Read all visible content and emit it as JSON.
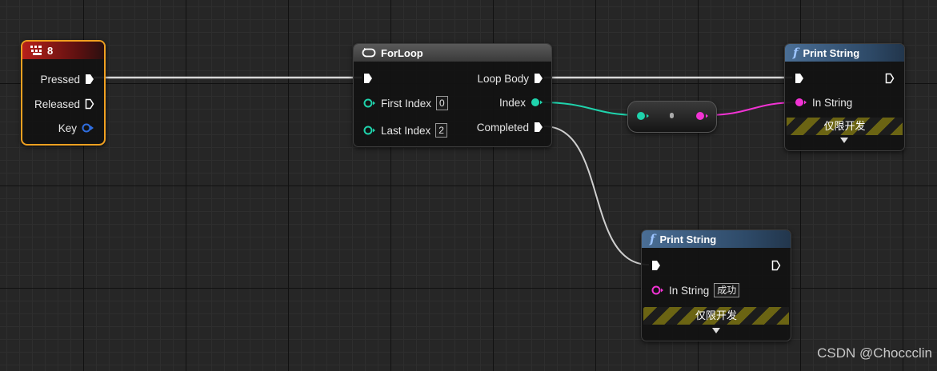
{
  "key_event": {
    "title": "8",
    "pins": {
      "pressed": "Pressed",
      "released": "Released",
      "key": "Key"
    },
    "icon": "keyboard-icon"
  },
  "for_loop": {
    "title": "ForLoop",
    "icon": "loop-icon",
    "first_index_label": "First Index",
    "first_index_value": "0",
    "last_index_label": "Last Index",
    "last_index_value": "2",
    "loop_body_label": "Loop Body",
    "index_label": "Index",
    "completed_label": "Completed"
  },
  "print_string_1": {
    "title": "Print String",
    "in_string_label": "In String",
    "dev_only_label": "仅限开发"
  },
  "print_string_2": {
    "title": "Print String",
    "in_string_label": "In String",
    "in_string_value": "成功",
    "dev_only_label": "仅限开发"
  },
  "watermark": "CSDN @Choccclin",
  "colors": {
    "exec": "#ffffff",
    "integer": "#1fd3ac",
    "string": "#f233d4",
    "key_struct": "#2f6ee0",
    "selection": "#f0a020"
  }
}
